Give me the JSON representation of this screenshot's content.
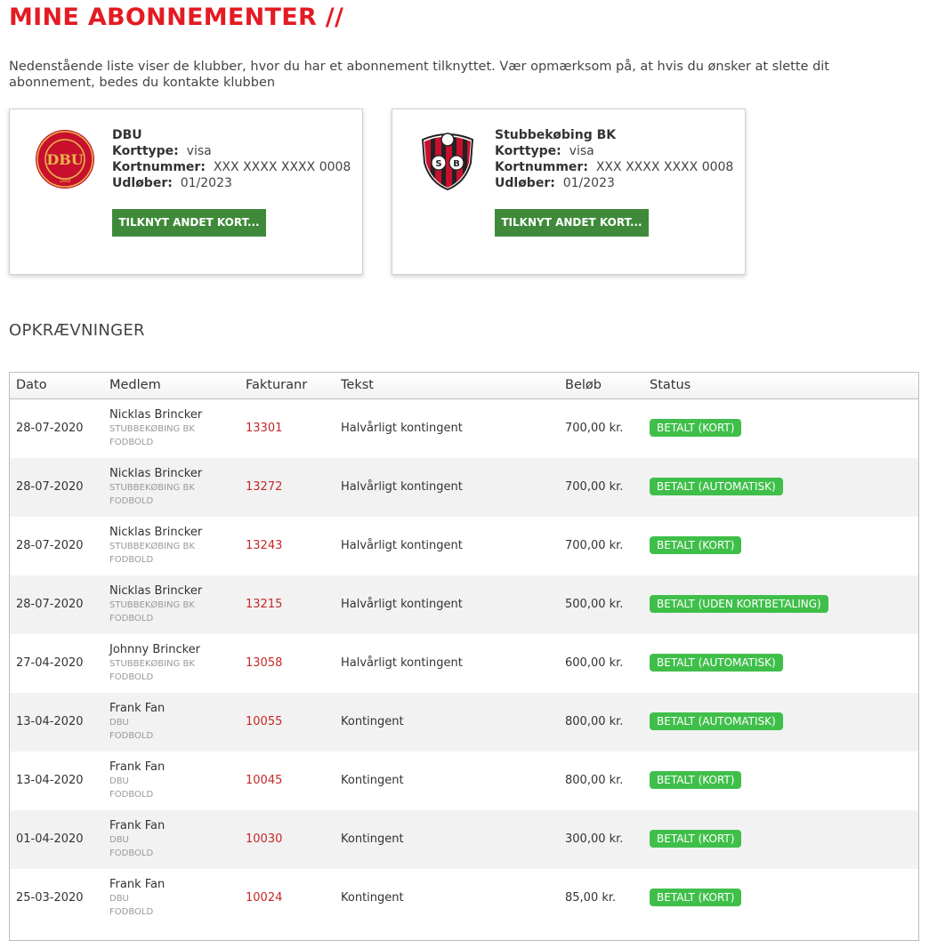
{
  "page": {
    "title": "MINE ABONNEMENTER //",
    "intro": "Nedenstående liste viser de klubber, hvor du har et abonnement tilknyttet. Vær opmærksom på, at hvis du ønsker at slette dit abonnement, bedes du kontakte klubben"
  },
  "subscriptions": [
    {
      "club": "DBU",
      "logo_icon": "dbu-crest-icon",
      "card_type_label": "Korttype:",
      "card_type": "visa",
      "card_number_label": "Kortnummer:",
      "card_number": "XXX XXXX XXXX 0008",
      "expiry_label": "Udløber:",
      "expiry": "01/2023",
      "button_label": "TILKNYT ANDET KORT..."
    },
    {
      "club": "Stubbekøbing BK",
      "logo_icon": "stubbekobing-shield-icon",
      "card_type_label": "Korttype:",
      "card_type": "visa",
      "card_number_label": "Kortnummer:",
      "card_number": "XXX XXXX XXXX 0008",
      "expiry_label": "Udløber:",
      "expiry": "01/2023",
      "button_label": "TILKNYT ANDET KORT..."
    }
  ],
  "charges": {
    "heading": "OPKRÆVNINGER",
    "columns": [
      "Dato",
      "Medlem",
      "Fakturanr",
      "Tekst",
      "Beløb",
      "Status"
    ],
    "rows": [
      {
        "date": "28-07-2020",
        "name": "Nicklas Brincker",
        "club": "STUBBEKØBING BK",
        "dept": "FODBOLD",
        "invoice": "13301",
        "text": "Halvårligt kontingent",
        "amount": "700,00 kr.",
        "status": "BETALT (KORT)"
      },
      {
        "date": "28-07-2020",
        "name": "Nicklas Brincker",
        "club": "STUBBEKØBING BK",
        "dept": "FODBOLD",
        "invoice": "13272",
        "text": "Halvårligt kontingent",
        "amount": "700,00 kr.",
        "status": "BETALT (AUTOMATISK)"
      },
      {
        "date": "28-07-2020",
        "name": "Nicklas Brincker",
        "club": "STUBBEKØBING BK",
        "dept": "FODBOLD",
        "invoice": "13243",
        "text": "Halvårligt kontingent",
        "amount": "700,00 kr.",
        "status": "BETALT (KORT)"
      },
      {
        "date": "28-07-2020",
        "name": "Nicklas Brincker",
        "club": "STUBBEKØBING BK",
        "dept": "FODBOLD",
        "invoice": "13215",
        "text": "Halvårligt kontingent",
        "amount": "500,00 kr.",
        "status": "BETALT (UDEN KORTBETALING)"
      },
      {
        "date": "27-04-2020",
        "name": "Johnny Brincker",
        "club": "STUBBEKØBING BK",
        "dept": "FODBOLD",
        "invoice": "13058",
        "text": "Halvårligt kontingent",
        "amount": "600,00 kr.",
        "status": "BETALT (AUTOMATISK)"
      },
      {
        "date": "13-04-2020",
        "name": "Frank Fan",
        "club": "DBU",
        "dept": "FODBOLD",
        "invoice": "10055",
        "text": "Kontingent",
        "amount": "800,00 kr.",
        "status": "BETALT (AUTOMATISK)"
      },
      {
        "date": "13-04-2020",
        "name": "Frank Fan",
        "club": "DBU",
        "dept": "FODBOLD",
        "invoice": "10045",
        "text": "Kontingent",
        "amount": "800,00 kr.",
        "status": "BETALT (KORT)"
      },
      {
        "date": "01-04-2020",
        "name": "Frank Fan",
        "club": "DBU",
        "dept": "FODBOLD",
        "invoice": "10030",
        "text": "Kontingent",
        "amount": "300,00 kr.",
        "status": "BETALT (KORT)"
      },
      {
        "date": "25-03-2020",
        "name": "Frank Fan",
        "club": "DBU",
        "dept": "FODBOLD",
        "invoice": "10024",
        "text": "Kontingent",
        "amount": "85,00 kr.",
        "status": "BETALT (KORT)"
      }
    ]
  },
  "colors": {
    "title_red": "#e31b23",
    "button_green": "#3f8a3a",
    "status_green": "#3fbf4a",
    "invoice_red": "#c62828"
  }
}
